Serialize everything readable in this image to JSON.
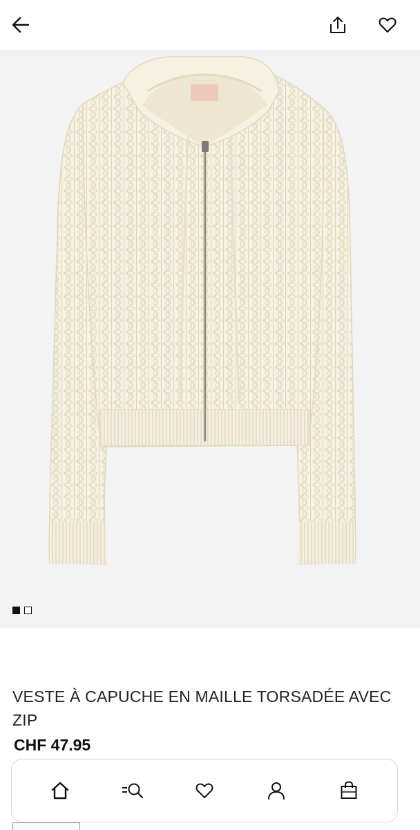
{
  "header": {
    "back_icon": "arrow-left-icon",
    "share_icon": "share-icon",
    "favorite_icon": "heart-icon"
  },
  "gallery": {
    "image_alt": "Cream cable-knit zip hoodie",
    "current_index": 1,
    "total": 2
  },
  "product": {
    "title": "VESTE À CAPUCHE EN MAILLE TORSADÉE AVEC ZIP",
    "price": "CHF 47.95"
  },
  "bottom_nav": [
    {
      "icon": "home-icon",
      "active": true
    },
    {
      "icon": "search-icon"
    },
    {
      "icon": "heart-icon"
    },
    {
      "icon": "user-icon"
    },
    {
      "icon": "shopping-bag-icon"
    }
  ],
  "colors": {
    "garment": "#f6f1e1",
    "background": "#f3f3f3",
    "text": "#111111"
  }
}
